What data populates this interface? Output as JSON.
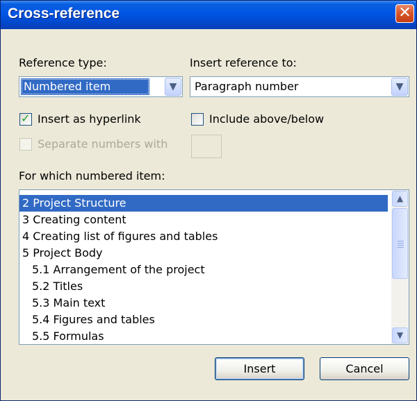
{
  "window": {
    "title": "Cross-reference",
    "close_glyph": "✕"
  },
  "reference_type": {
    "label": "Reference type:",
    "value": "Numbered item"
  },
  "insert_reference_to": {
    "label": "Insert reference to:",
    "value": "Paragraph number"
  },
  "checkboxes": {
    "insert_as_hyperlink": {
      "label": "Insert as hyperlink",
      "checked": true
    },
    "include_above_below": {
      "label": "Include above/below",
      "checked": false
    },
    "separate_numbers_with": {
      "label": "Separate numbers with",
      "checked": false,
      "disabled": true
    }
  },
  "list": {
    "label": "For which numbered item:",
    "items": [
      "2 Project Structure",
      "3 Creating content",
      "4 Creating list of figures and tables",
      "5 Project Body",
      "5.1 Arrangement of the project",
      "5.2 Titles",
      "5.3 Main text",
      "5.4 Figures and tables",
      "5.5 Formulas"
    ],
    "selected_index": 0
  },
  "buttons": {
    "insert": "Insert",
    "cancel": "Cancel"
  },
  "icons": {
    "dropdown": "chevron-down-icon",
    "scroll_up": "arrow-up-icon",
    "scroll_down": "arrow-down-icon"
  },
  "colors": {
    "title_bar": "#0055e5",
    "selection": "#316ac5",
    "dialog_bg": "#ece9d8"
  }
}
